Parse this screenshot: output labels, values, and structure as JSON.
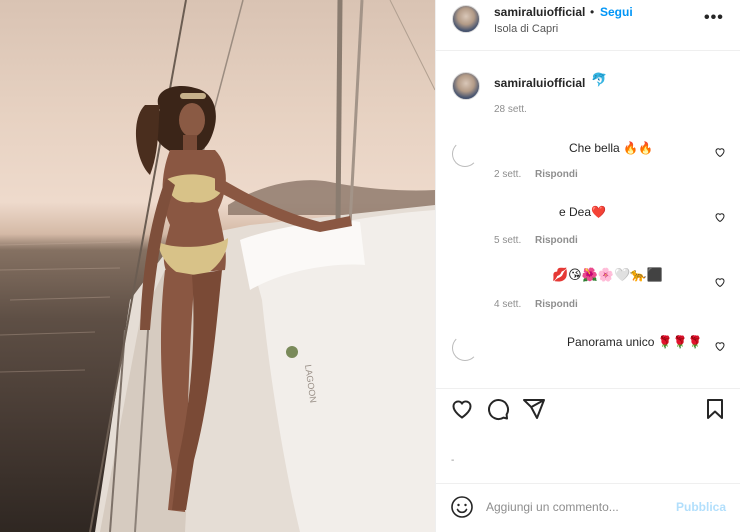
{
  "post": {
    "username": "samiraluiofficial",
    "separator": "•",
    "follow_label": "Segui",
    "location": "Isola di Capri",
    "more_label": "•••",
    "image_text": "LAGOON"
  },
  "caption": {
    "username": "samiraluiofficial",
    "emoji": "🐬",
    "time": "28 sett."
  },
  "comments": [
    {
      "text": "Che bella 🔥🔥",
      "time": "2 sett.",
      "reply": "Rispondi"
    },
    {
      "text": "e Dea❤️",
      "time": "5 sett.",
      "reply": "Rispondi"
    },
    {
      "text": "💋😘🌺🌸🤍🐆⬛",
      "time": "4 sett.",
      "reply": "Rispondi"
    },
    {
      "text": "Panorama unico 🌹🌹🌹",
      "time": "",
      "reply": ""
    }
  ],
  "likes_placeholder": "-",
  "composer": {
    "placeholder": "Aggiungi un commento...",
    "publish_label": "Pubblica"
  },
  "colors": {
    "accent": "#0095f6",
    "publish_disabled": "#b2dffc",
    "muted_text": "#8e8e8e"
  },
  "icons": [
    "emoji-icon",
    "heart-icon",
    "comment-icon",
    "share-icon",
    "bookmark-icon",
    "more-icon"
  ]
}
